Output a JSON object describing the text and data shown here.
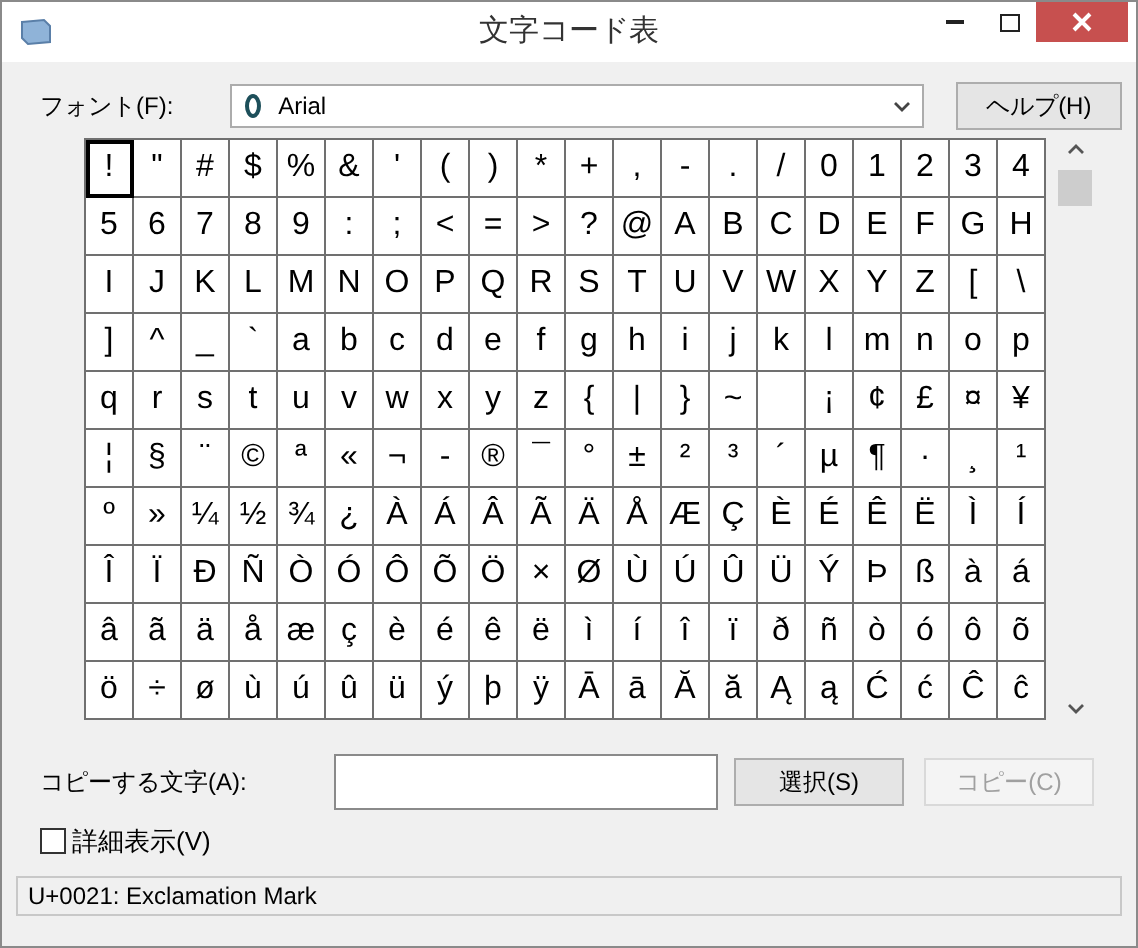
{
  "window": {
    "title": "文字コード表"
  },
  "font_label": "フォント(F):",
  "font_select": {
    "value": "Arial"
  },
  "help_button": "ヘルプ(H)",
  "grid": {
    "rows": [
      [
        {
          "char": "!",
          "selected": true
        },
        {
          "char": "\"",
          "selected": false
        },
        {
          "char": "#",
          "selected": false
        },
        {
          "char": "$",
          "selected": false
        },
        {
          "char": "%",
          "selected": false
        },
        {
          "char": "&",
          "selected": false
        },
        {
          "char": "'",
          "selected": false
        },
        {
          "char": "(",
          "selected": false
        },
        {
          "char": ")",
          "selected": false
        },
        {
          "char": "*",
          "selected": false
        },
        {
          "char": "+",
          "selected": false
        },
        {
          "char": ",",
          "selected": false
        },
        {
          "char": "-",
          "selected": false
        },
        {
          "char": ".",
          "selected": false
        },
        {
          "char": "/",
          "selected": false
        },
        {
          "char": "0",
          "selected": false
        },
        {
          "char": "1",
          "selected": false
        },
        {
          "char": "2",
          "selected": false
        },
        {
          "char": "3",
          "selected": false
        },
        {
          "char": "4",
          "selected": false
        }
      ],
      [
        {
          "char": "5",
          "selected": false
        },
        {
          "char": "6",
          "selected": false
        },
        {
          "char": "7",
          "selected": false
        },
        {
          "char": "8",
          "selected": false
        },
        {
          "char": "9",
          "selected": false
        },
        {
          "char": ":",
          "selected": false
        },
        {
          "char": ";",
          "selected": false
        },
        {
          "char": "<",
          "selected": false
        },
        {
          "char": "=",
          "selected": false
        },
        {
          "char": ">",
          "selected": false
        },
        {
          "char": "?",
          "selected": false
        },
        {
          "char": "@",
          "selected": false
        },
        {
          "char": "A",
          "selected": false
        },
        {
          "char": "B",
          "selected": false
        },
        {
          "char": "C",
          "selected": false
        },
        {
          "char": "D",
          "selected": false
        },
        {
          "char": "E",
          "selected": false
        },
        {
          "char": "F",
          "selected": false
        },
        {
          "char": "G",
          "selected": false
        },
        {
          "char": "H",
          "selected": false
        }
      ],
      [
        {
          "char": "I",
          "selected": false
        },
        {
          "char": "J",
          "selected": false
        },
        {
          "char": "K",
          "selected": false
        },
        {
          "char": "L",
          "selected": false
        },
        {
          "char": "M",
          "selected": false
        },
        {
          "char": "N",
          "selected": false
        },
        {
          "char": "O",
          "selected": false
        },
        {
          "char": "P",
          "selected": false
        },
        {
          "char": "Q",
          "selected": false
        },
        {
          "char": "R",
          "selected": false
        },
        {
          "char": "S",
          "selected": false
        },
        {
          "char": "T",
          "selected": false
        },
        {
          "char": "U",
          "selected": false
        },
        {
          "char": "V",
          "selected": false
        },
        {
          "char": "W",
          "selected": false
        },
        {
          "char": "X",
          "selected": false
        },
        {
          "char": "Y",
          "selected": false
        },
        {
          "char": "Z",
          "selected": false
        },
        {
          "char": "[",
          "selected": false
        },
        {
          "char": "\\",
          "selected": false
        }
      ],
      [
        {
          "char": "]",
          "selected": false
        },
        {
          "char": "^",
          "selected": false
        },
        {
          "char": "_",
          "selected": false
        },
        {
          "char": "`",
          "selected": false
        },
        {
          "char": "a",
          "selected": false
        },
        {
          "char": "b",
          "selected": false
        },
        {
          "char": "c",
          "selected": false
        },
        {
          "char": "d",
          "selected": false
        },
        {
          "char": "e",
          "selected": false
        },
        {
          "char": "f",
          "selected": false
        },
        {
          "char": "g",
          "selected": false
        },
        {
          "char": "h",
          "selected": false
        },
        {
          "char": "i",
          "selected": false
        },
        {
          "char": "j",
          "selected": false
        },
        {
          "char": "k",
          "selected": false
        },
        {
          "char": "l",
          "selected": false
        },
        {
          "char": "m",
          "selected": false
        },
        {
          "char": "n",
          "selected": false
        },
        {
          "char": "o",
          "selected": false
        },
        {
          "char": "p",
          "selected": false
        }
      ],
      [
        {
          "char": "q",
          "selected": false
        },
        {
          "char": "r",
          "selected": false
        },
        {
          "char": "s",
          "selected": false
        },
        {
          "char": "t",
          "selected": false
        },
        {
          "char": "u",
          "selected": false
        },
        {
          "char": "v",
          "selected": false
        },
        {
          "char": "w",
          "selected": false
        },
        {
          "char": "x",
          "selected": false
        },
        {
          "char": "y",
          "selected": false
        },
        {
          "char": "z",
          "selected": false
        },
        {
          "char": "{",
          "selected": false
        },
        {
          "char": "|",
          "selected": false
        },
        {
          "char": "}",
          "selected": false
        },
        {
          "char": "~",
          "selected": false
        },
        {
          "selected": false
        },
        {
          "char": "¡",
          "selected": false
        },
        {
          "char": "¢",
          "selected": false
        },
        {
          "char": "£",
          "selected": false
        },
        {
          "char": "¤",
          "selected": false
        },
        {
          "char": "¥",
          "selected": false
        }
      ],
      [
        {
          "char": "¦",
          "selected": false
        },
        {
          "char": "§",
          "selected": false
        },
        {
          "char": "¨",
          "selected": false
        },
        {
          "char": "©",
          "selected": false
        },
        {
          "char": "ª",
          "selected": false
        },
        {
          "char": "«",
          "selected": false
        },
        {
          "char": "¬",
          "selected": false
        },
        {
          "char": "-",
          "selected": false
        },
        {
          "char": "®",
          "selected": false
        },
        {
          "char": "¯",
          "selected": false
        },
        {
          "char": "°",
          "selected": false
        },
        {
          "char": "±",
          "selected": false
        },
        {
          "char": "²",
          "selected": false
        },
        {
          "char": "³",
          "selected": false
        },
        {
          "char": "´",
          "selected": false
        },
        {
          "char": "µ",
          "selected": false
        },
        {
          "char": "¶",
          "selected": false
        },
        {
          "char": "·",
          "selected": false
        },
        {
          "char": "¸",
          "selected": false
        },
        {
          "char": "¹",
          "selected": false
        }
      ],
      [
        {
          "char": "º",
          "selected": false
        },
        {
          "char": "»",
          "selected": false
        },
        {
          "char": "¼",
          "selected": false
        },
        {
          "char": "½",
          "selected": false
        },
        {
          "char": "¾",
          "selected": false
        },
        {
          "char": "¿",
          "selected": false
        },
        {
          "char": "À",
          "selected": false
        },
        {
          "char": "Á",
          "selected": false
        },
        {
          "char": "Â",
          "selected": false
        },
        {
          "char": "Ã",
          "selected": false
        },
        {
          "char": "Ä",
          "selected": false
        },
        {
          "char": "Å",
          "selected": false
        },
        {
          "char": "Æ",
          "selected": false
        },
        {
          "char": "Ç",
          "selected": false
        },
        {
          "char": "È",
          "selected": false
        },
        {
          "char": "É",
          "selected": false
        },
        {
          "char": "Ê",
          "selected": false
        },
        {
          "char": "Ë",
          "selected": false
        },
        {
          "char": "Ì",
          "selected": false
        },
        {
          "char": "Í",
          "selected": false
        }
      ],
      [
        {
          "char": "Î",
          "selected": false
        },
        {
          "char": "Ï",
          "selected": false
        },
        {
          "char": "Ð",
          "selected": false
        },
        {
          "char": "Ñ",
          "selected": false
        },
        {
          "char": "Ò",
          "selected": false
        },
        {
          "char": "Ó",
          "selected": false
        },
        {
          "char": "Ô",
          "selected": false
        },
        {
          "char": "Õ",
          "selected": false
        },
        {
          "char": "Ö",
          "selected": false
        },
        {
          "char": "×",
          "selected": false
        },
        {
          "char": "Ø",
          "selected": false
        },
        {
          "char": "Ù",
          "selected": false
        },
        {
          "char": "Ú",
          "selected": false
        },
        {
          "char": "Û",
          "selected": false
        },
        {
          "char": "Ü",
          "selected": false
        },
        {
          "char": "Ý",
          "selected": false
        },
        {
          "char": "Þ",
          "selected": false
        },
        {
          "char": "ß",
          "selected": false
        },
        {
          "char": "à",
          "selected": false
        },
        {
          "char": "á",
          "selected": false
        }
      ],
      [
        {
          "char": "â",
          "selected": false
        },
        {
          "char": "ã",
          "selected": false
        },
        {
          "char": "ä",
          "selected": false
        },
        {
          "char": "å",
          "selected": false
        },
        {
          "char": "æ",
          "selected": false
        },
        {
          "char": "ç",
          "selected": false
        },
        {
          "char": "è",
          "selected": false
        },
        {
          "char": "é",
          "selected": false
        },
        {
          "char": "ê",
          "selected": false
        },
        {
          "char": "ë",
          "selected": false
        },
        {
          "char": "ì",
          "selected": false
        },
        {
          "char": "í",
          "selected": false
        },
        {
          "char": "î",
          "selected": false
        },
        {
          "char": "ï",
          "selected": false
        },
        {
          "char": "ð",
          "selected": false
        },
        {
          "char": "ñ",
          "selected": false
        },
        {
          "char": "ò",
          "selected": false
        },
        {
          "char": "ó",
          "selected": false
        },
        {
          "char": "ô",
          "selected": false
        },
        {
          "char": "õ",
          "selected": false
        }
      ],
      [
        {
          "char": "ö",
          "selected": false
        },
        {
          "char": "÷",
          "selected": false
        },
        {
          "char": "ø",
          "selected": false
        },
        {
          "char": "ù",
          "selected": false
        },
        {
          "char": "ú",
          "selected": false
        },
        {
          "char": "û",
          "selected": false
        },
        {
          "char": "ü",
          "selected": false
        },
        {
          "char": "ý",
          "selected": false
        },
        {
          "char": "þ",
          "selected": false
        },
        {
          "char": "ÿ",
          "selected": false
        },
        {
          "char": "Ā",
          "selected": false
        },
        {
          "char": "ā",
          "selected": false
        },
        {
          "char": "Ă",
          "selected": false
        },
        {
          "char": "ă",
          "selected": false
        },
        {
          "char": "Ą",
          "selected": false
        },
        {
          "char": "ą",
          "selected": false
        },
        {
          "char": "Ć",
          "selected": false
        },
        {
          "char": "ć",
          "selected": false
        },
        {
          "char": "Ĉ",
          "selected": false
        },
        {
          "char": "ĉ",
          "selected": false
        }
      ]
    ]
  },
  "copy_label": "コピーする文字(A):",
  "select_button": "選択(S)",
  "copy_button": {
    "label": "コピー(C)",
    "disabled": true
  },
  "advanced_view": {
    "label": "詳細表示(V)",
    "checked": false
  },
  "status_bar": "U+0021: Exclamation Mark"
}
